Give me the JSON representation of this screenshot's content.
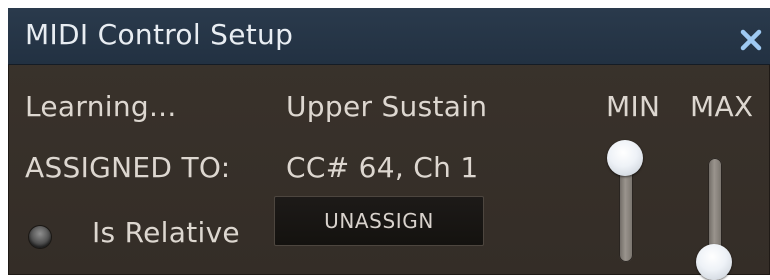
{
  "window": {
    "title": "MIDI Control Setup",
    "close_glyph": "✕"
  },
  "status": {
    "learning_label": "Learning...",
    "parameter_name": "Upper Sustain",
    "assigned_label": "ASSIGNED TO:",
    "assigned_value": "CC# 64, Ch 1"
  },
  "relative": {
    "label": "Is Relative",
    "state": "off"
  },
  "unassign_button": {
    "label": "UNASSIGN"
  },
  "range": {
    "min_label": "MIN",
    "max_label": "MAX",
    "min_value": 1.0,
    "max_value": 0.0
  },
  "colors": {
    "title_bar": "#223142",
    "panel": "#352e28",
    "close_icon": "#9ec9f2",
    "text": "#ddd7d0"
  }
}
